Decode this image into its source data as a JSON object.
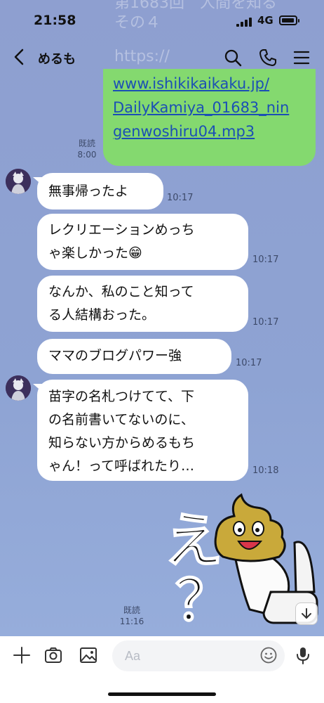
{
  "status_bar": {
    "time": "21:58",
    "network": "4G"
  },
  "header": {
    "title": "めるも"
  },
  "faded_banner": {
    "line1": "第1683回　人間を知る",
    "line2": "その４",
    "line3": "https://"
  },
  "link_message": {
    "lines": [
      "www.ishikikaikaku.jp/",
      "DailyKamiya_01683_nin",
      "genwoshiru04.mp3"
    ],
    "read_label": "既読",
    "time": "8:00"
  },
  "messages": [
    {
      "lines": [
        "無事帰ったよ"
      ],
      "time": "10:17"
    },
    {
      "lines": [
        "レクリエーションめっち",
        "ゃ楽しかった😁"
      ],
      "time": "10:17"
    },
    {
      "lines": [
        "なんか、私のこと知って",
        "る人結構おった。"
      ],
      "time": "10:17"
    },
    {
      "lines": [
        "ママのブログパワー強"
      ],
      "time": "10:17"
    },
    {
      "lines": [
        "苗字の名札つけてて、下",
        "の名前書いてないのに、",
        "知らない方からめるもち",
        "ゃん！って呼ばれたり…"
      ],
      "time": "10:18"
    }
  ],
  "sticker": {
    "text1": "え",
    "text2": "？",
    "read_label": "既読",
    "time": "11:16"
  },
  "input_bar": {
    "placeholder": "Aa"
  },
  "colors": {
    "chat_bg": "#8fa3d2",
    "link_bubble": "#84d96f",
    "link_text": "#1b4fb5",
    "bubble": "#ffffff"
  },
  "icons": [
    "back-icon",
    "search-icon",
    "phone-icon",
    "menu-icon",
    "plus-icon",
    "camera-icon",
    "image-icon",
    "emoji-icon",
    "mic-icon",
    "arrow-down-icon"
  ]
}
